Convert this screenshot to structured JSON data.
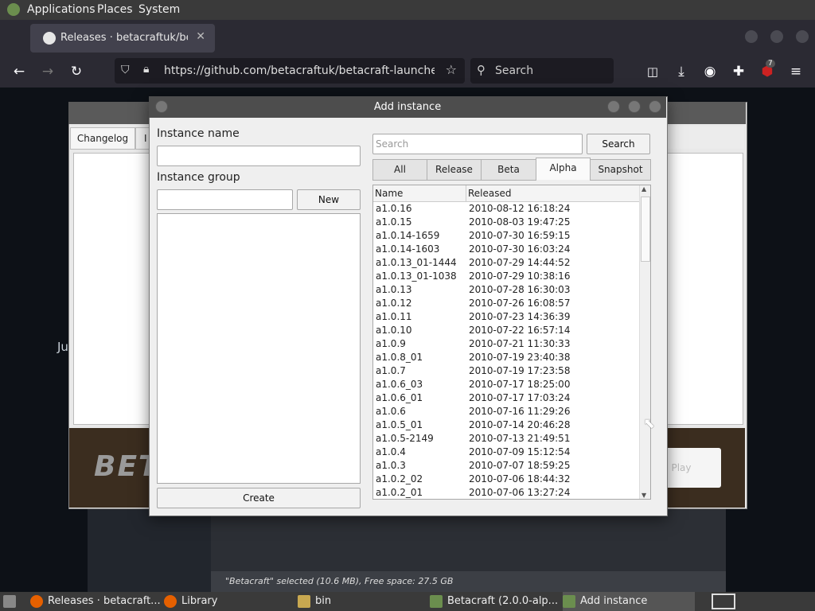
{
  "system_panel": {
    "menus": [
      "Applications",
      "Places",
      "System"
    ]
  },
  "browser": {
    "tab_title": "Releases · betacraftuk/beta",
    "tab_close": "✕",
    "url": "https://github.com/betacraftuk/betacraft-launcher/rele",
    "search_placeholder": "Search",
    "extension_badge": "7"
  },
  "background_page": {
    "side_text": "Ju",
    "status_text": "\"Betacraft\" selected (10.6 MB), Free space: 27.5 GB"
  },
  "launcher": {
    "tab_changelog": "Changelog",
    "tab_partial": "I",
    "banner_logo": "BET",
    "play_label": "Play"
  },
  "dialog": {
    "title": "Add instance",
    "instance_name_label": "Instance name",
    "instance_name_value": "",
    "instance_group_label": "Instance group",
    "instance_group_value": "",
    "new_button": "New",
    "create_button": "Create",
    "search_placeholder": "Search",
    "search_button": "Search",
    "tabs": [
      "All",
      "Release",
      "Beta",
      "Alpha",
      "Snapshot"
    ],
    "active_tab": "Alpha",
    "columns": [
      "Name",
      "Released"
    ],
    "rows": [
      [
        "a1.0.16",
        "2010-08-12 16:18:24"
      ],
      [
        "a1.0.15",
        "2010-08-03 19:47:25"
      ],
      [
        "a1.0.14-1659",
        "2010-07-30 16:59:15"
      ],
      [
        "a1.0.14-1603",
        "2010-07-30 16:03:24"
      ],
      [
        "a1.0.13_01-1444",
        "2010-07-29 14:44:52"
      ],
      [
        "a1.0.13_01-1038",
        "2010-07-29 10:38:16"
      ],
      [
        "a1.0.13",
        "2010-07-28 16:30:03"
      ],
      [
        "a1.0.12",
        "2010-07-26 16:08:57"
      ],
      [
        "a1.0.11",
        "2010-07-23 14:36:39"
      ],
      [
        "a1.0.10",
        "2010-07-22 16:57:14"
      ],
      [
        "a1.0.9",
        "2010-07-21 11:30:33"
      ],
      [
        "a1.0.8_01",
        "2010-07-19 23:40:38"
      ],
      [
        "a1.0.7",
        "2010-07-19 17:23:58"
      ],
      [
        "a1.0.6_03",
        "2010-07-17 18:25:00"
      ],
      [
        "a1.0.6_01",
        "2010-07-17 17:03:24"
      ],
      [
        "a1.0.6",
        "2010-07-16 11:29:26"
      ],
      [
        "a1.0.5_01",
        "2010-07-14 20:46:28"
      ],
      [
        "a1.0.5-2149",
        "2010-07-13 21:49:51"
      ],
      [
        "a1.0.4",
        "2010-07-09 15:12:54"
      ],
      [
        "a1.0.3",
        "2010-07-07 18:59:25"
      ],
      [
        "a1.0.2_02",
        "2010-07-06 18:44:32"
      ],
      [
        "a1.0.2_01",
        "2010-07-06 13:27:24"
      ]
    ]
  },
  "taskbar": {
    "items": [
      "Releases · betacraft...",
      "Library",
      "bin",
      "Betacraft (2.0.0-alp...",
      "Add instance"
    ],
    "active_item": "Add instance"
  },
  "colors": {
    "panel": "#3a3a3a",
    "browser": "#2b2a33",
    "page": "#0d1117",
    "dialog": "#efefef"
  }
}
